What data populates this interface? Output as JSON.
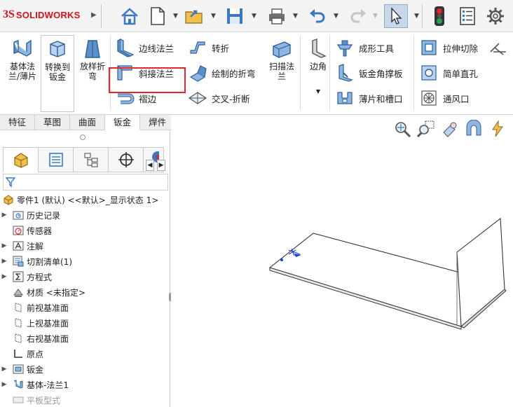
{
  "app": {
    "brand_mark": "3S",
    "brand_name": "SOLIDWORKS"
  },
  "toolbar": {
    "icons": [
      "home-icon",
      "new-document-icon",
      "open-icon",
      "save-icon",
      "print-icon",
      "undo-icon",
      "redo-icon",
      "select-cursor-icon",
      "traffic-light-icon",
      "options-list-icon",
      "gear-icon"
    ]
  },
  "ribbon": {
    "base_flange": "基体法兰/薄片",
    "convert_to_sheet_metal": "转换到钣金",
    "lofted_bend": "放样折弯",
    "edge_flange": "边线法兰",
    "miter_flange": "斜接法兰",
    "hem": "褶边",
    "jog": "转折",
    "sketched_bend": "绘制的折弯",
    "cross_break": "交叉-折断",
    "swept_flange": "扫描法兰",
    "corners": "边角",
    "forming_tool": "成形工具",
    "sheet_metal_gusset": "钣金角撑板",
    "tab_and_slot": "薄片和槽口",
    "extruded_cut": "拉伸切除",
    "simple_hole": "简单直孔",
    "vent": "通风口"
  },
  "tabs": [
    "特征",
    "草图",
    "曲面",
    "钣金",
    "焊件"
  ],
  "active_tab": "钣金",
  "tree": {
    "root": "零件1 (默认) <<默认>_显示状态 1>",
    "items": [
      {
        "label": "历史记录",
        "icon": "history-folder-icon",
        "expandable": true
      },
      {
        "label": "传感器",
        "icon": "sensor-icon",
        "expandable": false
      },
      {
        "label": "注解",
        "icon": "annotation-icon",
        "expandable": true
      },
      {
        "label": "切割清单(1)",
        "icon": "cut-list-icon",
        "expandable": true
      },
      {
        "label": "方程式",
        "icon": "equation-icon",
        "expandable": true
      },
      {
        "label": "材质 <未指定>",
        "icon": "material-icon",
        "expandable": false
      },
      {
        "label": "前视基准面",
        "icon": "plane-icon",
        "expandable": false
      },
      {
        "label": "上视基准面",
        "icon": "plane-icon",
        "expandable": false
      },
      {
        "label": "右视基准面",
        "icon": "plane-icon",
        "expandable": false
      },
      {
        "label": "原点",
        "icon": "origin-icon",
        "expandable": false
      },
      {
        "label": "钣金",
        "icon": "sheet-metal-folder-icon",
        "expandable": true
      },
      {
        "label": "基体-法兰1",
        "icon": "base-flange-feature-icon",
        "expandable": true
      },
      {
        "label": "平板型式",
        "icon": "flat-pattern-icon",
        "expandable": false
      }
    ]
  },
  "colors": {
    "brand_red": "#d2121a",
    "highlight_red": "#e2262c",
    "icon_blue": "#3b78c2",
    "model_edge": "#333333"
  }
}
